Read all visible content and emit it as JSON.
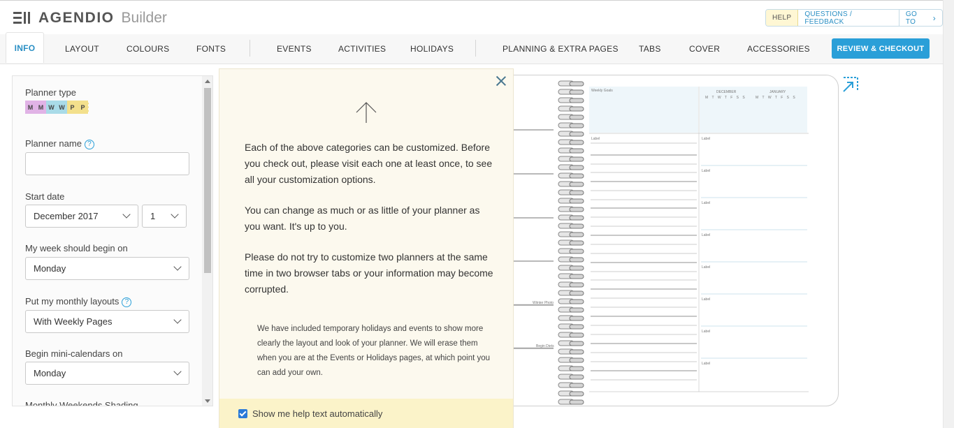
{
  "app": {
    "brand": "AGENDIO",
    "product": "Builder"
  },
  "header": {
    "help_label": "HELP",
    "feedback_label": "QUESTIONS / FEEDBACK",
    "goto_label": "GO TO",
    "goto_arrow": "›"
  },
  "nav": {
    "tabs": [
      {
        "label": "INFO",
        "active": true
      },
      {
        "label": "LAYOUT"
      },
      {
        "label": "COLOURS"
      },
      {
        "label": "FONTS"
      },
      {
        "label": "EVENTS"
      },
      {
        "label": "ACTIVITIES"
      },
      {
        "label": "HOLIDAYS"
      },
      {
        "label": "PLANNING & EXTRA PAGES"
      },
      {
        "label": "TABS"
      },
      {
        "label": "COVER"
      },
      {
        "label": "ACCESSORIES"
      }
    ],
    "checkout_label": "REVIEW & CHECKOUT"
  },
  "form": {
    "planner_type_label": "Planner type",
    "planner_type_chips": [
      {
        "letter": "M",
        "color": "#e1b3e6"
      },
      {
        "letter": "M",
        "color": "#e1b3e6"
      },
      {
        "letter": "W",
        "color": "#a9dbe8"
      },
      {
        "letter": "W",
        "color": "#a9dbe8"
      },
      {
        "letter": "P",
        "color": "#f3e08c"
      },
      {
        "letter": "P",
        "color": "#f3e08c"
      }
    ],
    "planner_name_label": "Planner name",
    "planner_name_value": "",
    "start_date_label": "Start date",
    "start_month_value": "December 2017",
    "start_day_value": "1",
    "week_begin_label": "My week should begin on",
    "week_begin_value": "Monday",
    "monthly_layout_label": "Put my monthly layouts",
    "monthly_layout_value": "With Weekly Pages",
    "mini_cal_label": "Begin mini-calendars on",
    "mini_cal_value": "Monday",
    "weekend_shading_label": "Monthly Weekends Shading",
    "help_icon": "?"
  },
  "help_popup": {
    "para1": "Each of the above categories can be customized. Before you check out, please visit each one at least once, to see all your customization options.",
    "para2": "You can change as much or as little of your planner as you want. It's up to you.",
    "para3": "Please do not try to customize two planners at the same time in two browser tabs or your information may become corrupted.",
    "note": "We have included temporary holidays and events to show more clearly the layout and look of your planner. We will erase them when you are at the Events or Holidays pages, at which point you can add your own.",
    "checkbox_label": "Show me help text automatically",
    "checkbox_checked": true
  },
  "preview": {
    "weekly_goals": "Weekly Goals",
    "month_left": "DECEMBER",
    "month_right": "JANUARY",
    "weekdays": "M T W T F S S",
    "slot_label": "Label",
    "margin_note_1": "Wiinter Photo",
    "margin_note_2": "Begin Diets"
  },
  "colors": {
    "accent": "#2a9fd8",
    "help_bg": "#fcf9ee",
    "help_footer": "#fbf3c9"
  }
}
